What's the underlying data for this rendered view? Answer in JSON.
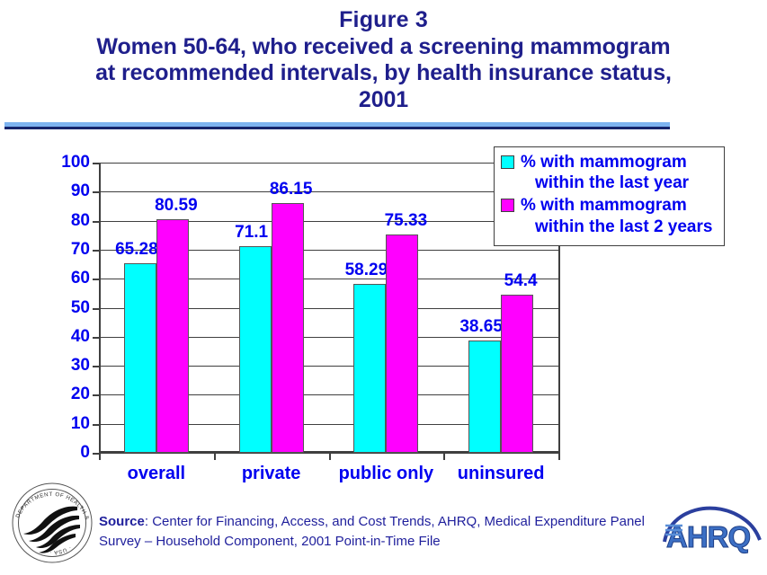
{
  "title": {
    "line1": "Figure 3",
    "line2": "Women 50-64, who received a screening mammogram",
    "line3": "at recommended intervals, by health insurance status,",
    "line4": "2001"
  },
  "legend": {
    "items": [
      {
        "line1": "% with mammogram",
        "line2": "within the last year",
        "color": "#00ffff"
      },
      {
        "line1": "% with mammogram",
        "line2": "within the last 2 years",
        "color": "#ff00ff"
      }
    ]
  },
  "source": {
    "label": "Source",
    "text": ": Center for Financing, Access, and Cost Trends, AHRQ, Medical Expenditure Panel Survey – Household Component, 2001 Point-in-Time File"
  },
  "logos": {
    "hhs": {
      "name": "hhs-seal",
      "ring_text": "DEPARTMENT OF HEALTH & HUMAN SERVICES·USA"
    },
    "ahrq": {
      "name": "ahrq-logo",
      "text": "AHRQ"
    }
  },
  "colors": {
    "title": "#1f1f8c",
    "axis_text": "#0000f0",
    "series_1": "#00ffff",
    "series_2": "#ff00ff",
    "rule_light": "#7db3f0",
    "rule_dark": "#14236b"
  },
  "chart_data": {
    "type": "bar",
    "title": "Women 50-64, who received a screening mammogram at recommended intervals, by health insurance status, 2001",
    "xlabel": "",
    "ylabel": "",
    "ylim": [
      0,
      100
    ],
    "yticks": [
      0,
      10,
      20,
      30,
      40,
      50,
      60,
      70,
      80,
      90,
      100
    ],
    "grid": true,
    "legend_position": "top-right",
    "categories": [
      "overall",
      "private",
      "public only",
      "uninsured"
    ],
    "series": [
      {
        "name": "% with mammogram within the last year",
        "color": "#00ffff",
        "values": [
          65.28,
          71.1,
          58.29,
          38.65
        ],
        "labels": [
          "65.28",
          "71.1",
          "58.29",
          "38.65"
        ]
      },
      {
        "name": "% with mammogram within the last 2 years",
        "color": "#ff00ff",
        "values": [
          80.59,
          86.15,
          75.33,
          54.4
        ],
        "labels": [
          "80.59",
          "86.15",
          "75.33",
          "54.4"
        ]
      }
    ]
  }
}
